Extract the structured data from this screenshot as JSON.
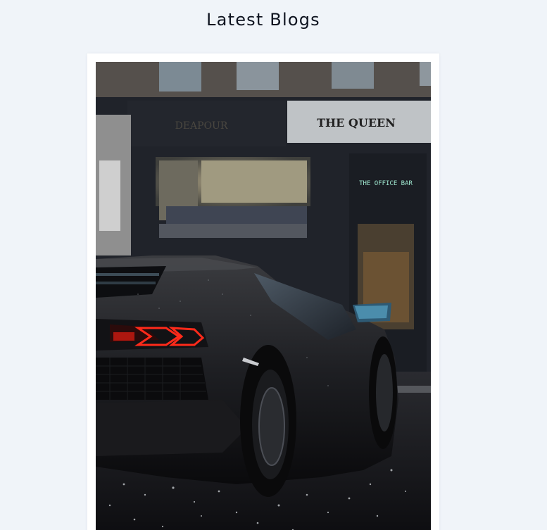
{
  "section": {
    "title": "Latest Blogs"
  },
  "blogs": [
    {
      "image_description_icon": "sports-car-photo",
      "store_sign_1": "DEAPOUR",
      "store_sign_2": "THE QUEEN",
      "store_sign_3": "THE OFFICE BAR"
    }
  ],
  "colors": {
    "page_background": "#f0f4f9",
    "card_background": "#ffffff",
    "title_text": "#0f1420",
    "tail_light": "#ff2a1a"
  }
}
